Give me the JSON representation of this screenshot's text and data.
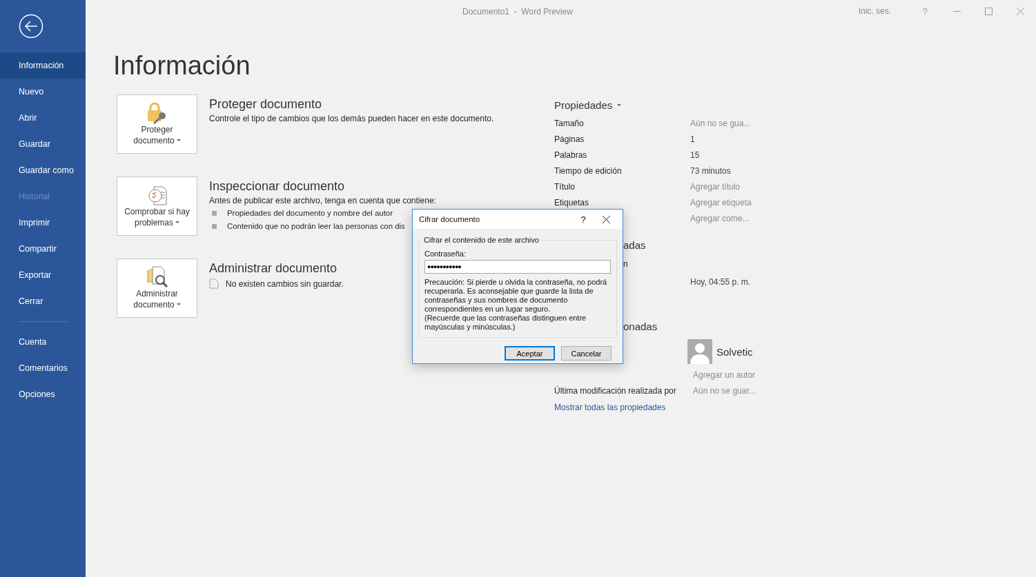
{
  "window": {
    "title": "Documento1  -  Word Preview",
    "sign_in": "Inic. ses.",
    "help": "?"
  },
  "sidebar": {
    "items": [
      {
        "label": "Información",
        "selected": true,
        "disabled": false
      },
      {
        "label": "Nuevo",
        "selected": false,
        "disabled": false
      },
      {
        "label": "Abrir",
        "selected": false,
        "disabled": false
      },
      {
        "label": "Guardar",
        "selected": false,
        "disabled": false
      },
      {
        "label": "Guardar como",
        "selected": false,
        "disabled": false
      },
      {
        "label": "Historial",
        "selected": false,
        "disabled": true
      },
      {
        "label": "Imprimir",
        "selected": false,
        "disabled": false
      },
      {
        "label": "Compartir",
        "selected": false,
        "disabled": false
      },
      {
        "label": "Exportar",
        "selected": false,
        "disabled": false
      },
      {
        "label": "Cerrar",
        "selected": false,
        "disabled": false
      }
    ],
    "footer_items": [
      {
        "label": "Cuenta",
        "selected": false,
        "disabled": false
      },
      {
        "label": "Comentarios",
        "selected": false,
        "disabled": false
      },
      {
        "label": "Opciones",
        "selected": false,
        "disabled": false
      }
    ]
  },
  "page_title": "Información",
  "sections": [
    {
      "kind": "protect",
      "button_lines": [
        "Proteger",
        "documento"
      ],
      "title": "Proteger documento",
      "description": "Controle el tipo de cambios que los demás pueden hacer en este documento."
    },
    {
      "kind": "inspect",
      "button_lines": [
        "Comprobar si hay",
        "problemas"
      ],
      "title": "Inspeccionar documento",
      "description": "Antes de publicar este archivo, tenga en cuenta que contiene:",
      "bullets": [
        "Propiedades del documento y nombre del autor",
        "Contenido que no podrán leer las personas con dis"
      ]
    },
    {
      "kind": "manage",
      "button_lines": [
        "Administrar",
        "documento"
      ],
      "title": "Administrar documento",
      "note": "No existen cambios sin guardar."
    }
  ],
  "properties": {
    "heading": "Propiedades",
    "rows": [
      {
        "label": "Tamaño",
        "value": "Aún no se gua...",
        "muted": true
      },
      {
        "label": "Páginas",
        "value": "1",
        "muted": false
      },
      {
        "label": "Palabras",
        "value": "15",
        "muted": false
      },
      {
        "label": "Tiempo de edición",
        "value": "73 minutos",
        "muted": false
      },
      {
        "label": "Título",
        "value": "Agregar título",
        "muted": true
      },
      {
        "label": "Etiquetas",
        "value": "Agregar etiqueta",
        "muted": true
      },
      {
        "value": "Agregar come...",
        "muted": true
      }
    ]
  },
  "related_dates": {
    "heading_fragment": "adas",
    "rows": [
      {
        "label_fragment": "n"
      },
      {
        "value": "Hoy, 04:55 p. m.",
        "muted": false
      }
    ]
  },
  "related_people": {
    "heading_fragment": "onadas",
    "author": "Solvetic",
    "add_author": "Agregar un autor",
    "rows": [
      {
        "label": "Última modificación realizada por",
        "value": "Aún no se guar...",
        "muted": true
      }
    ]
  },
  "show_all_link": "Mostrar todas las propiedades",
  "dialog": {
    "title": "Cifrar documento",
    "help": "?",
    "group_label": "Cifrar el contenido de este archivo",
    "field_label": "Contraseña:",
    "password": "●●●●●●●●●●●",
    "warning": "Precaución: Si pierde u olvida la contraseña, no podrá recuperarla. Es aconsejable que guarde la lista de contraseñas y sus nombres de documento correspondientes en un lugar seguro.",
    "note": "(Recuerde que las contraseñas distinguen entre mayúsculas y minúsculas.)",
    "buttons": [
      {
        "label": "Aceptar",
        "default": true
      },
      {
        "label": "Cancelar",
        "default": false
      }
    ]
  }
}
